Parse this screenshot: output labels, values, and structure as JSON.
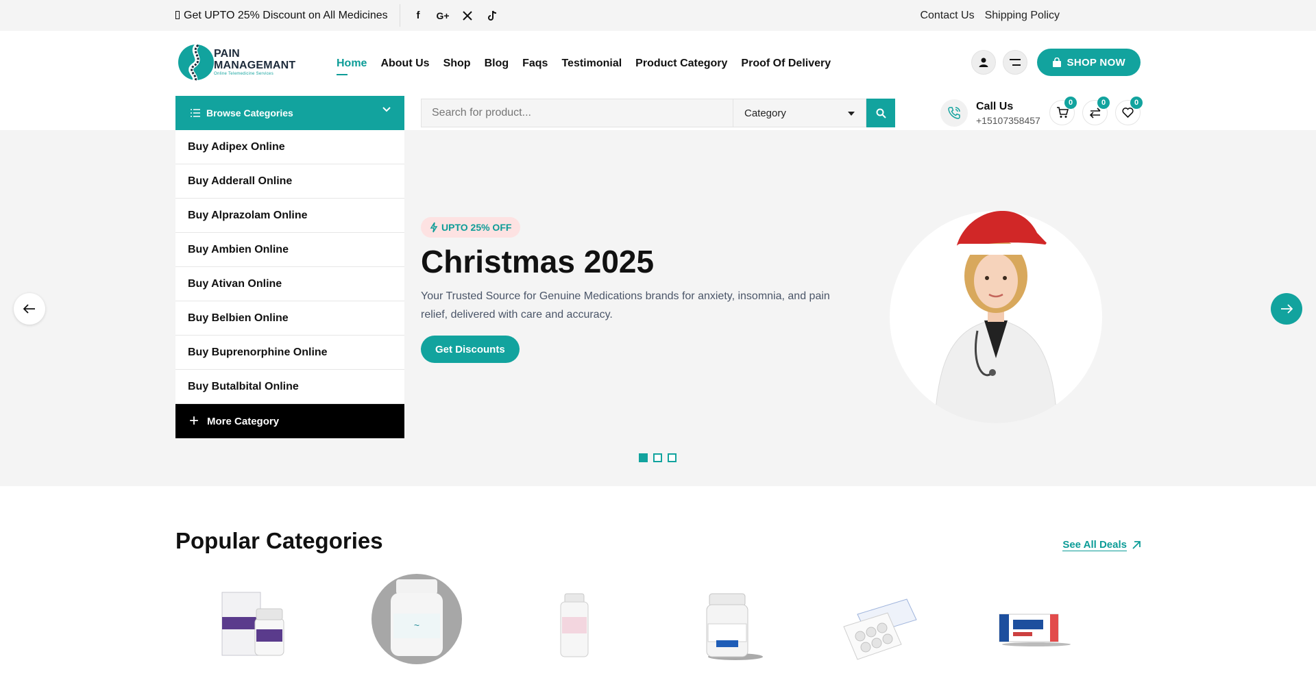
{
  "topbar": {
    "promo": "Get UPTO 25% Discount on All Medicines",
    "socials": [
      "facebook-icon",
      "google-plus-icon",
      "x-icon",
      "tiktok-icon"
    ],
    "links": [
      "Contact Us",
      "Shipping Policy"
    ]
  },
  "brand": {
    "line1": "PAIN",
    "line2": "MANAGEMANT",
    "tagline": "Online Telemedicine Services"
  },
  "nav": {
    "items": [
      "Home",
      "About Us",
      "Shop",
      "Blog",
      "Faqs",
      "Testimonial",
      "Product Category",
      "Proof Of Delivery"
    ],
    "active": "Home"
  },
  "header": {
    "shop_now": "SHOP NOW"
  },
  "search": {
    "browse_label": "Browse Categories",
    "placeholder": "Search for product...",
    "category_label": "Category"
  },
  "call": {
    "label": "Call Us",
    "number": "+15107358457"
  },
  "counters": {
    "cart": "0",
    "compare": "0",
    "wishlist": "0"
  },
  "categories": {
    "items": [
      "Buy Adipex Online",
      "Buy Adderall Online",
      "Buy Alprazolam Online",
      "Buy Ambien Online",
      "Buy Ativan Online",
      "Buy Belbien Online",
      "Buy Buprenorphine Online",
      "Buy Butalbital Online"
    ],
    "more": "More Category"
  },
  "hero": {
    "badge": "UPTO 25% OFF",
    "title": "Christmas 2025",
    "subtitle": "Your Trusted Source for Genuine Medications brands for anxiety, insomnia, and pain relief, delivered with care and accuracy.",
    "cta": "Get Discounts",
    "slide_count": 3,
    "active_slide": 1
  },
  "popular": {
    "title": "Popular Categories",
    "see_all": "See All Deals"
  },
  "colors": {
    "accent": "#12a39e",
    "badge_bg": "#fde2e2",
    "hero_bg": "#f4f4f4"
  }
}
